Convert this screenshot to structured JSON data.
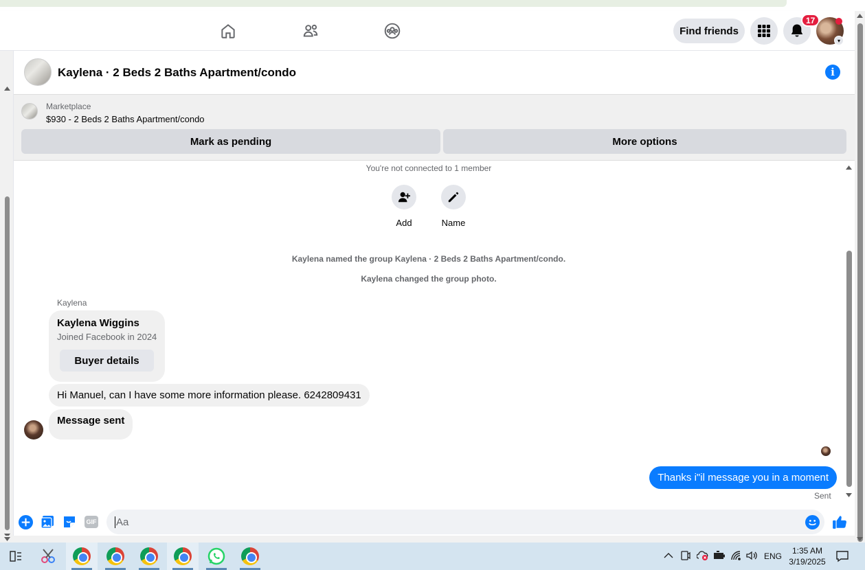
{
  "chat": {
    "title": "Kaylena · 2 Beds 2 Baths Apartment/condo"
  },
  "topnav": {
    "find_friends_label": "Find friends",
    "notification_count": "17"
  },
  "marketplace": {
    "label": "Marketplace",
    "listing": "$930 - 2 Beds 2 Baths Apartment/condo",
    "mark_pending_label": "Mark as pending",
    "more_options_label": "More options"
  },
  "conversation": {
    "not_connected": "You're not connected to 1 member",
    "actions": [
      {
        "label": "Add",
        "icon": "add-person-icon"
      },
      {
        "label": "Name",
        "icon": "pencil-icon"
      }
    ],
    "events": [
      "Kaylena named the group Kaylena · 2 Beds 2 Baths Apartment/condo.",
      "Kaylena changed the group photo."
    ],
    "sender_name": "Kaylena",
    "buyer_card": {
      "name": "Kaylena Wiggins",
      "subtitle": "Joined Facebook in 2024",
      "button_label": "Buyer details"
    },
    "incoming_messages": [
      "Hi Manuel, can I have some more information please. 6242809431",
      "Message sent"
    ],
    "outgoing_message": "Thanks i\"il message you in a moment",
    "outgoing_status": "Sent"
  },
  "composer": {
    "placeholder": "Aa",
    "gif_label": "GIF"
  },
  "taskbar": {
    "language": "ENG",
    "time": "1:35 AM",
    "date": "3/19/2025"
  },
  "colors": {
    "messenger_blue": "#0a7cff",
    "notification_red": "#e41e3f",
    "bubble_gray": "#f0f0f0"
  }
}
